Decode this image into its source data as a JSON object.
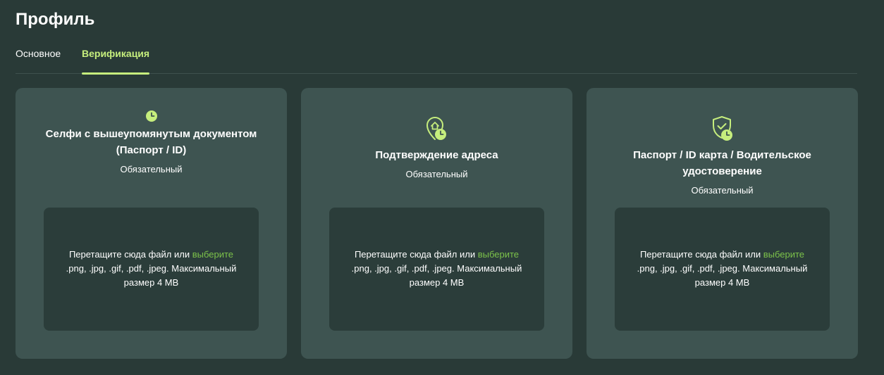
{
  "page": {
    "title": "Профиль"
  },
  "tabs": [
    {
      "label": "Основное",
      "active": false
    },
    {
      "label": "Верификация",
      "active": true
    }
  ],
  "colors": {
    "accent": "#c6ee7d",
    "link": "#7cc24a",
    "background": "#293a37",
    "card": "#3e5451",
    "dropzone": "#2b3d3a"
  },
  "cards": [
    {
      "icon": "clock-icon",
      "title": "Селфи с вышеупомянутым документом (Паспорт / ID)",
      "status": "Обязательный",
      "dropzone": {
        "text": "Перетащите сюда файл или",
        "link": "выберите",
        "formats": ".png, .jpg, .gif, .pdf, .jpeg. Максимальный размер 4 MB"
      }
    },
    {
      "icon": "home-location-clock-icon",
      "title": "Подтверждение адреса",
      "status": "Обязательный",
      "dropzone": {
        "text": "Перетащите сюда файл или",
        "link": "выберите",
        "formats": ".png, .jpg, .gif, .pdf, .jpeg. Максимальный размер 4 MB"
      }
    },
    {
      "icon": "shield-check-clock-icon",
      "title": "Паспорт / ID карта / Водительское удостоверение",
      "status": "Обязательный",
      "dropzone": {
        "text": "Перетащите сюда файл или",
        "link": "выберите",
        "formats": ".png, .jpg, .gif, .pdf, .jpeg. Максимальный размер 4 MB"
      }
    }
  ]
}
